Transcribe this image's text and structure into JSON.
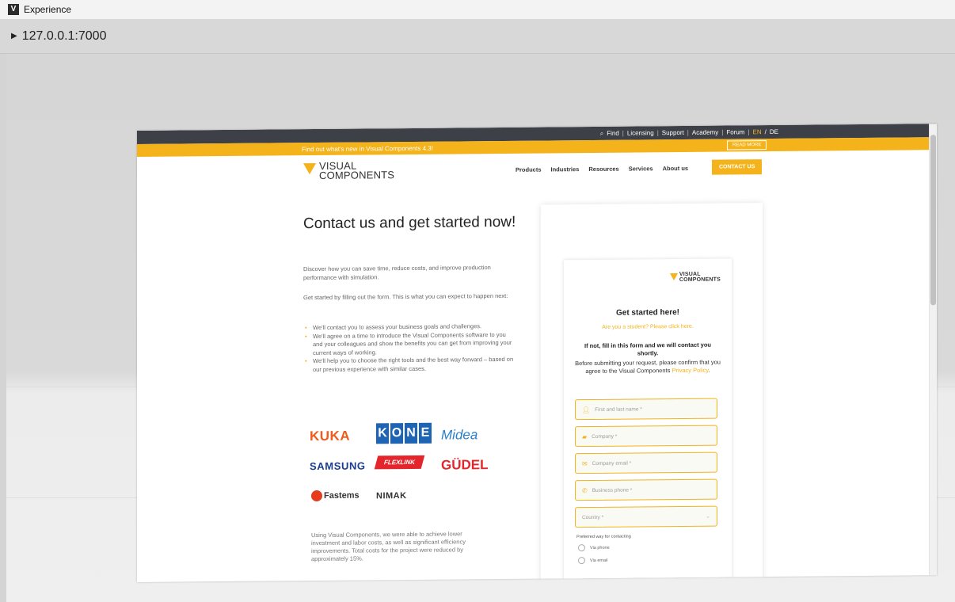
{
  "window": {
    "title": "Experience",
    "icon": "app-logo-icon"
  },
  "address": {
    "url": "127.0.0.1:7000",
    "icon": "expand-arrow-icon"
  },
  "site": {
    "topbar": {
      "find": "Find",
      "licensing": "Licensing",
      "support": "Support",
      "academy": "Academy",
      "forum": "Forum",
      "lang_en": "EN",
      "lang_de": "DE",
      "search_icon": "search-icon"
    },
    "announcement": {
      "text": "Find out what's new in Visual Components 4.3!",
      "button": "READ MORE"
    },
    "logo": {
      "line1": "VISUAL",
      "line2": "COMPONENTS"
    },
    "nav": [
      "Products",
      "Industries",
      "Resources",
      "Services",
      "About us"
    ],
    "cta": "CONTACT US",
    "hero_title": "Contact us and get started now!",
    "intro": "Discover how you can save time, reduce costs, and improve production performance with simulation.",
    "expect": "Get started by filling out the form. This is what you can expect to happen next:",
    "bullets": [
      "We'll contact you to assess your business goals and challenges.",
      "We'll agree on a time to introduce the Visual Components software to you and your colleagues and show the benefits you can get from improving your current ways of working.",
      "We'll help you to choose the right tools and the best way forward – based on our previous experience with similar cases."
    ],
    "clients": {
      "kuka": "KUKA",
      "kone": [
        "K",
        "O",
        "N",
        "E"
      ],
      "midea": "Midea",
      "samsung": "SAMSUNG",
      "flexlink": "FLEXLINK",
      "gudel": "GÜDEL",
      "fastems": "Fastems",
      "nimak": "NIMAK"
    },
    "quote": "Using Visual Components, we were able to achieve lower investment and labor costs, as well as significant efficiency improvements. Total costs for the project were reduced by approximately 15%."
  },
  "form": {
    "logo": {
      "line1": "VISUAL",
      "line2": "COMPONENTS"
    },
    "title": "Get started here!",
    "student_link": "Are you a student? Please click here.",
    "intro": "If not, fill in this form and we will contact you shortly.",
    "desc_pre": "Before submitting your request, please confirm that you agree to the Visual Components ",
    "privacy": "Privacy Policy",
    "desc_post": ".",
    "fields": {
      "name": {
        "placeholder": "First and last name *",
        "icon": "user-icon"
      },
      "company": {
        "placeholder": "Company *",
        "icon": "building-icon"
      },
      "email": {
        "placeholder": "Company email *",
        "icon": "mail-icon"
      },
      "phone": {
        "placeholder": "Business phone *",
        "icon": "phone-icon"
      },
      "country": {
        "placeholder": "Country *",
        "icon": "chevron-down-icon"
      }
    },
    "preferred_label": "Preferred way for contacting",
    "radio_phone": "Via phone",
    "radio_email": "Via email"
  },
  "colors": {
    "accent": "#f4b31b",
    "topbar": "#3e4047"
  }
}
